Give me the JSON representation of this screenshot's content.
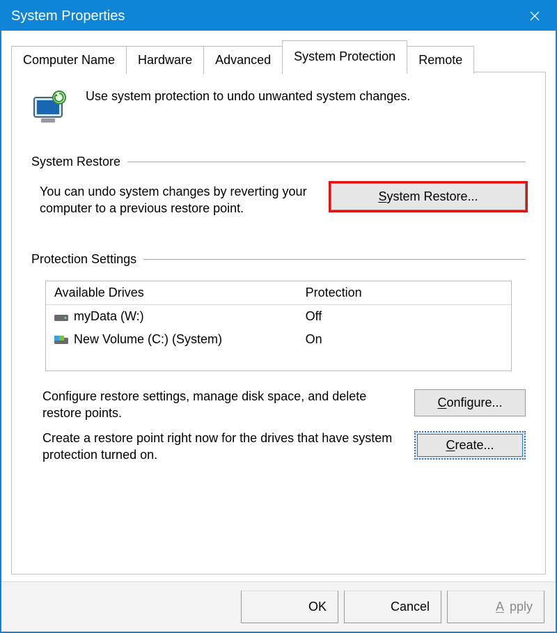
{
  "window": {
    "title": "System Properties"
  },
  "tabs": {
    "computer_name": "Computer Name",
    "hardware": "Hardware",
    "advanced": "Advanced",
    "system_protection": "System Protection",
    "remote": "Remote"
  },
  "panel": {
    "intro": "Use system protection to undo unwanted system changes.",
    "section_restore": "System Restore",
    "restore_text": "You can undo system changes by reverting your computer to a previous restore point.",
    "restore_button_prefix": "S",
    "restore_button_rest": "ystem Restore...",
    "section_protection": "Protection Settings",
    "drives_header_available": "Available Drives",
    "drives_header_protection": "Protection",
    "drives": [
      {
        "name": "myData (W:)",
        "protection": "Off",
        "icon": "hdd"
      },
      {
        "name": "New Volume (C:) (System)",
        "protection": "On",
        "icon": "sys"
      }
    ],
    "configure_text": "Configure restore settings, manage disk space, and delete restore points.",
    "configure_button_prefix": "C",
    "configure_button_rest": "onfigure...",
    "create_text": "Create a restore point right now for the drives that have system protection turned on.",
    "create_button_prefix": "C",
    "create_button_rest": "reate..."
  },
  "footer": {
    "ok": "OK",
    "cancel": "Cancel",
    "apply_prefix": "A",
    "apply_rest": "pply"
  },
  "colors": {
    "accent": "#0e85d6",
    "highlight": "#e31313"
  }
}
